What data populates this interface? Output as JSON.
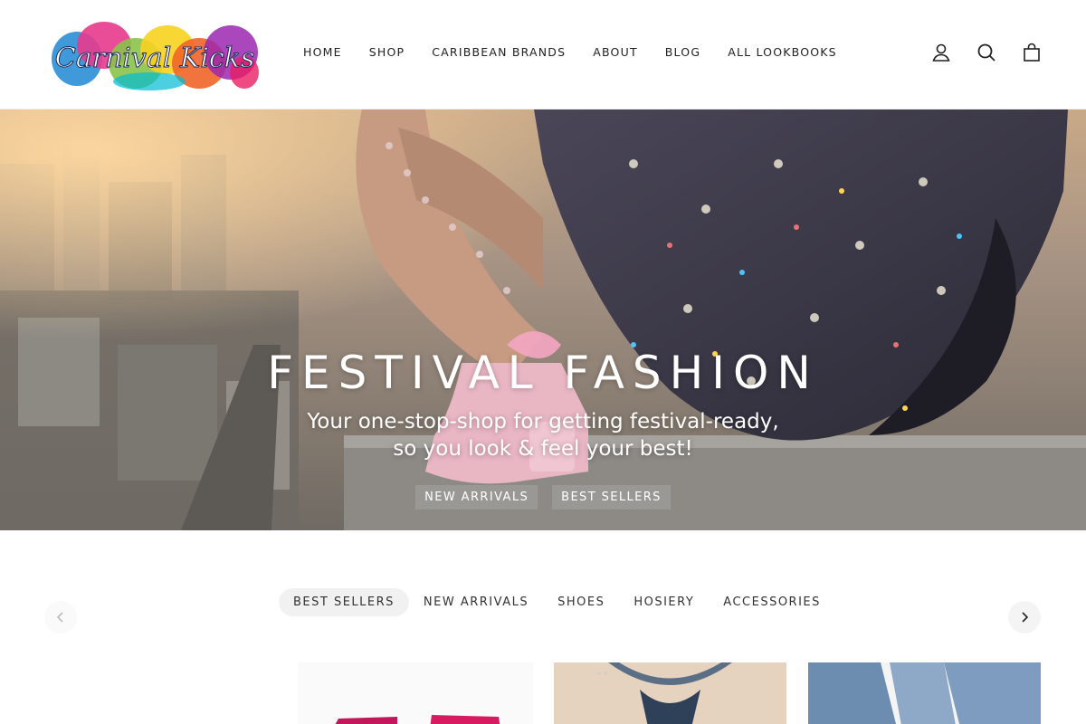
{
  "header": {
    "logo_text": "Carnival Kicks",
    "nav": [
      "HOME",
      "SHOP",
      "CARIBBEAN BRANDS",
      "ABOUT",
      "BLOG",
      "ALL LOOKBOOKS"
    ],
    "icons": [
      "account-icon",
      "search-icon",
      "cart-icon"
    ]
  },
  "hero": {
    "title": "FESTIVAL FASHION",
    "subtitle_line1": "Your one-stop-shop for getting festival-ready,",
    "subtitle_line2": "so you look & feel your best!",
    "buttons": [
      "NEW ARRIVALS",
      "BEST SELLERS"
    ]
  },
  "collection_tabs": {
    "items": [
      "BEST SELLERS",
      "NEW ARRIVALS",
      "SHOES",
      "HOSIERY",
      "ACCESSORIES"
    ],
    "active": "BEST SELLERS"
  },
  "carousel": {
    "prev_icon": "chevron-left-icon",
    "next_icon": "chevron-right-icon"
  },
  "colors": {
    "accent": "#222222",
    "tab_active_bg": "#f1f1f1",
    "hero_text": "#ffffff"
  }
}
